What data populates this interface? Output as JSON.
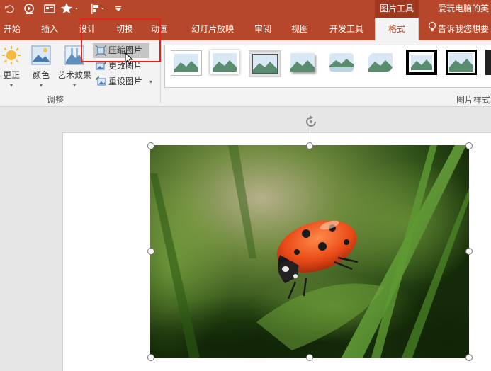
{
  "quick_access": {
    "icons": [
      "undo-icon",
      "slideshow-icon",
      "textbox-icon",
      "star-icon",
      "align-icon",
      "customize-icon"
    ]
  },
  "context_group": {
    "label": "图片工具"
  },
  "doc_title": "爱玩电脑的英",
  "tabs": [
    {
      "label": "开始"
    },
    {
      "label": "插入"
    },
    {
      "label": "设计"
    },
    {
      "label": "切换"
    },
    {
      "label": "动画"
    },
    {
      "label": "幻灯片放映"
    },
    {
      "label": "审阅"
    },
    {
      "label": "视图"
    },
    {
      "label": "开发工具"
    },
    {
      "label": "格式"
    }
  ],
  "tell_me": "告诉我您想要",
  "ribbon": {
    "adjust": {
      "correct": "更正",
      "color": "颜色",
      "art_effects": "艺术效果",
      "compress": "压缩图片",
      "change": "更改图片",
      "reset": "重设图片",
      "group_label": "调整"
    },
    "styles": {
      "group_label": "图片样式",
      "thumbnails": [
        "simple-frame-white",
        "soft-edge-rectangle",
        "double-frame-black",
        "drop-shadow-rectangle",
        "reflected-rounded",
        "rounded-diagonal",
        "thick-matte-black",
        "simple-frame-black",
        "metal-frame"
      ]
    }
  },
  "colors": {
    "accent": "#b7472a",
    "accent_dark": "#9f381f",
    "highlight_box": "#e2231a"
  },
  "image": {
    "subject": "ladybug-on-grass"
  }
}
